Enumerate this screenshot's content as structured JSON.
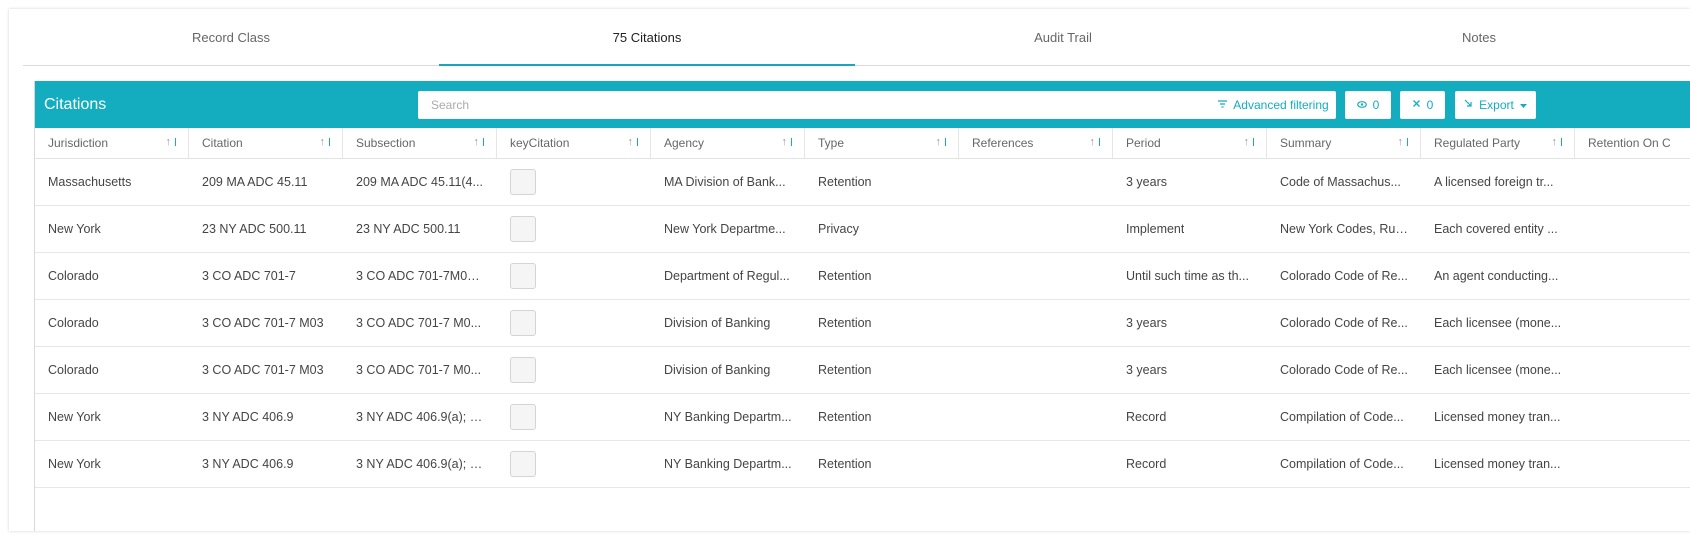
{
  "tabs": [
    {
      "label": "Record Class",
      "active": false
    },
    {
      "label": "75 Citations",
      "active": true
    },
    {
      "label": "Audit Trail",
      "active": false
    },
    {
      "label": "Notes",
      "active": false
    }
  ],
  "toolbar": {
    "title": "Citations",
    "search_placeholder": "Search",
    "advanced_filtering_label": "Advanced filtering",
    "visible_count": "0",
    "hidden_count": "0",
    "export_label": "Export"
  },
  "icons": {
    "filter": "filter-icon",
    "eye": "eye-icon",
    "hidden": "eye-off-icon",
    "export": "export-icon",
    "caret": "caret-down-icon",
    "sort": "sort-icon"
  },
  "colors": {
    "accent": "#13adbf",
    "tab_underline": "#1aa7bd"
  },
  "table": {
    "columns": [
      "Jurisdiction",
      "Citation",
      "Subsection",
      "keyCitation",
      "Agency",
      "Type",
      "References",
      "Period",
      "Summary",
      "Regulated Party",
      "Retention On C"
    ],
    "rows": [
      {
        "jurisdiction": "Massachusetts",
        "citation": "209 MA ADC 45.11",
        "subsection": "209 MA ADC 45.11(4...",
        "agency": "MA Division of Bank...",
        "type": "Retention",
        "references": "",
        "period": "3 years",
        "summary": "Code of Massachus...",
        "regulated_party": "A licensed foreign tr...",
        "retention_on": ""
      },
      {
        "jurisdiction": "New York",
        "citation": "23 NY ADC 500.11",
        "subsection": "23 NY ADC 500.11",
        "agency": "New York Departme...",
        "type": "Privacy",
        "references": "",
        "period": "Implement",
        "summary": "New York Codes, Rul...",
        "regulated_party": "Each covered entity ...",
        "retention_on": ""
      },
      {
        "jurisdiction": "Colorado",
        "citation": "3 CO ADC 701-7",
        "subsection": "3 CO ADC 701-7M08...",
        "agency": "Department of Regul...",
        "type": "Retention",
        "references": "",
        "period": "Until such time as th...",
        "summary": "Colorado Code of Re...",
        "regulated_party": "An agent conducting...",
        "retention_on": ""
      },
      {
        "jurisdiction": "Colorado",
        "citation": "3 CO ADC 701-7 M03",
        "subsection": "3 CO ADC 701-7 M0...",
        "agency": "Division of Banking",
        "type": "Retention",
        "references": "",
        "period": "3 years",
        "summary": "Colorado Code of Re...",
        "regulated_party": "Each licensee (mone...",
        "retention_on": ""
      },
      {
        "jurisdiction": "Colorado",
        "citation": "3 CO ADC 701-7 M03",
        "subsection": "3 CO ADC 701-7 M0...",
        "agency": "Division of Banking",
        "type": "Retention",
        "references": "",
        "period": "3 years",
        "summary": "Colorado Code of Re...",
        "regulated_party": "Each licensee (mone...",
        "retention_on": ""
      },
      {
        "jurisdiction": "New York",
        "citation": "3 NY ADC 406.9",
        "subsection": "3 NY ADC 406.9(a); (...",
        "agency": "NY Banking Departm...",
        "type": "Retention",
        "references": "",
        "period": "Record",
        "summary": "Compilation of Code...",
        "regulated_party": "Licensed money tran...",
        "retention_on": ""
      },
      {
        "jurisdiction": "New York",
        "citation": "3 NY ADC 406.9",
        "subsection": "3 NY ADC 406.9(a); (...",
        "agency": "NY Banking Departm...",
        "type": "Retention",
        "references": "",
        "period": "Record",
        "summary": "Compilation of Code...",
        "regulated_party": "Licensed money tran...",
        "retention_on": ""
      }
    ]
  }
}
